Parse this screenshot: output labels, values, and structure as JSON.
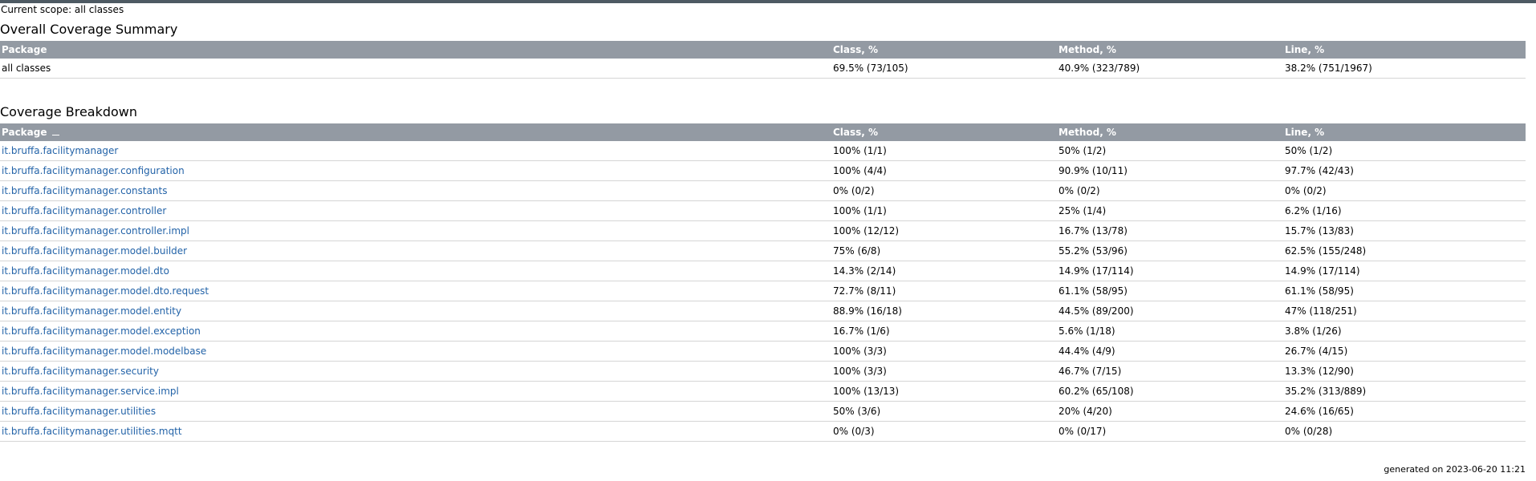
{
  "scope": "Current scope: all classes",
  "summary": {
    "title": "Overall Coverage Summary",
    "headers": [
      "Package",
      "Class, %",
      "Method, %",
      "Line, %"
    ],
    "row": {
      "package": "all classes",
      "class": "69.5% (73/105)",
      "method": "40.9% (323/789)",
      "line": "38.2% (751/1967)"
    }
  },
  "breakdown": {
    "title": "Coverage Breakdown",
    "headers": [
      "Package",
      "Class, %",
      "Method, %",
      "Line, %"
    ],
    "sort_icon": "sort-ascending-icon",
    "rows": [
      {
        "package": "it.bruffa.facilitymanager",
        "class": "100% (1/1)",
        "method": "50% (1/2)",
        "line": "50% (1/2)"
      },
      {
        "package": "it.bruffa.facilitymanager.configuration",
        "class": "100% (4/4)",
        "method": "90.9% (10/11)",
        "line": "97.7% (42/43)"
      },
      {
        "package": "it.bruffa.facilitymanager.constants",
        "class": "0% (0/2)",
        "method": "0% (0/2)",
        "line": "0% (0/2)"
      },
      {
        "package": "it.bruffa.facilitymanager.controller",
        "class": "100% (1/1)",
        "method": "25% (1/4)",
        "line": "6.2% (1/16)"
      },
      {
        "package": "it.bruffa.facilitymanager.controller.impl",
        "class": "100% (12/12)",
        "method": "16.7% (13/78)",
        "line": "15.7% (13/83)"
      },
      {
        "package": "it.bruffa.facilitymanager.model.builder",
        "class": "75% (6/8)",
        "method": "55.2% (53/96)",
        "line": "62.5% (155/248)"
      },
      {
        "package": "it.bruffa.facilitymanager.model.dto",
        "class": "14.3% (2/14)",
        "method": "14.9% (17/114)",
        "line": "14.9% (17/114)"
      },
      {
        "package": "it.bruffa.facilitymanager.model.dto.request",
        "class": "72.7% (8/11)",
        "method": "61.1% (58/95)",
        "line": "61.1% (58/95)"
      },
      {
        "package": "it.bruffa.facilitymanager.model.entity",
        "class": "88.9% (16/18)",
        "method": "44.5% (89/200)",
        "line": "47% (118/251)"
      },
      {
        "package": "it.bruffa.facilitymanager.model.exception",
        "class": "16.7% (1/6)",
        "method": "5.6% (1/18)",
        "line": "3.8% (1/26)"
      },
      {
        "package": "it.bruffa.facilitymanager.model.modelbase",
        "class": "100% (3/3)",
        "method": "44.4% (4/9)",
        "line": "26.7% (4/15)"
      },
      {
        "package": "it.bruffa.facilitymanager.security",
        "class": "100% (3/3)",
        "method": "46.7% (7/15)",
        "line": "13.3% (12/90)"
      },
      {
        "package": "it.bruffa.facilitymanager.service.impl",
        "class": "100% (13/13)",
        "method": "60.2% (65/108)",
        "line": "35.2% (313/889)"
      },
      {
        "package": "it.bruffa.facilitymanager.utilities",
        "class": "50% (3/6)",
        "method": "20% (4/20)",
        "line": "24.6% (16/65)"
      },
      {
        "package": "it.bruffa.facilitymanager.utilities.mqtt",
        "class": "0% (0/3)",
        "method": "0% (0/17)",
        "line": "0% (0/28)"
      }
    ]
  },
  "footer": "generated on 2023-06-20 11:21",
  "colors": {
    "topbar": "#4e5a63",
    "header_bg": "#939aa3",
    "link": "#2363a8"
  }
}
